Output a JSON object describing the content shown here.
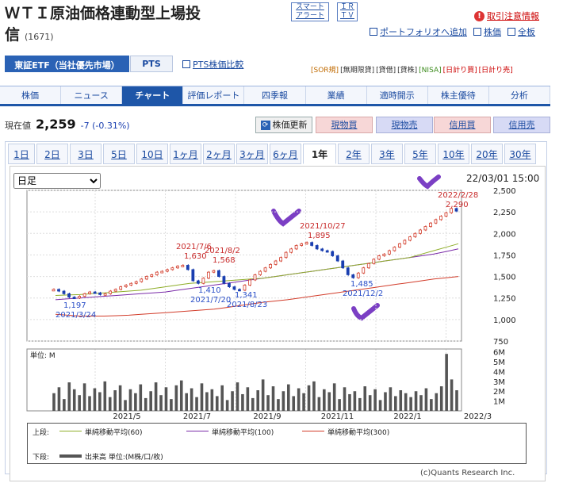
{
  "header": {
    "title_line1": "ＷＴＩ原油価格連動型上場投",
    "title_line2": "信",
    "code": "(1671)",
    "smart_alert_1": "スマート",
    "smart_alert_2": "アラート",
    "irtv_1": "ＩＲ",
    "irtv_2": "ＴＶ",
    "caution_link": "取引注意情報",
    "portfolio_link": "ポートフォリオへ追加",
    "stock_price_link": "株価",
    "full_board_link": "全板"
  },
  "market_tabs": {
    "etf": "東証ETF（当社優先市場）",
    "pts": "PTS",
    "pts_compare": "PTS株価比較"
  },
  "flags": [
    "[SOR規]",
    "[無期限貸]",
    "[貸借]",
    "[貸株]",
    "[NISA]",
    "[日計り買]",
    "[日計り売]"
  ],
  "nav": [
    "株価",
    "ニュース",
    "チャート",
    "評価レポート",
    "四季報",
    "業績",
    "適時開示",
    "株主優待",
    "分析"
  ],
  "price": {
    "label": "現在値",
    "value": "2,259",
    "change_prefix": "-7 (",
    "change_pct": "-0.31%",
    "change_suffix": ")"
  },
  "buttons": {
    "refresh": "株価更新",
    "buy_spot": "現物買",
    "sell_spot": "現物売",
    "buy_margin": "信用買",
    "sell_margin": "信用売"
  },
  "periods": [
    "1日",
    "2日",
    "3日",
    "5日",
    "10日",
    "1ヶ月",
    "2ヶ月",
    "3ヶ月",
    "6ヶ月",
    "1年",
    "2年",
    "3年",
    "5年",
    "10年",
    "20年",
    "30年"
  ],
  "chart": {
    "select_value": "日足",
    "timestamp": "22/03/01 15:00",
    "volume_unit_label": "単位: M",
    "legend_upper_label": "上段:",
    "legend_lower_label": "下段:",
    "ma60": "単純移動平均(60)",
    "ma100": "単純移動平均(100)",
    "ma300": "単純移動平均(300)",
    "volume_legend": "出来高 単位:(M株/口/枚)",
    "credit": "(c)Quants Research Inc.",
    "colors": {
      "ma60": "#8fae2a",
      "ma100": "#7a2ba8",
      "ma300": "#d23c2a",
      "candle": "#1a3fb0"
    }
  },
  "chart_data": {
    "type": "line",
    "price_ticks": [
      "2,500",
      "2,250",
      "2,000",
      "1,750",
      "1,500",
      "1,250",
      "1,000",
      "750"
    ],
    "volume_ticks": [
      "6M",
      "5M",
      "4M",
      "3M",
      "2M",
      "1M"
    ],
    "x_ticks": [
      "2021/5",
      "2021/7",
      "2021/9",
      "2021/11",
      "2022/1",
      "2022/3"
    ],
    "ylim": [
      750,
      2500
    ],
    "annotations": [
      {
        "date": "2021/3/24",
        "value": "1,197",
        "kind": "low"
      },
      {
        "date": "2021/7/6",
        "value": "1,630",
        "kind": "high"
      },
      {
        "date": "2021/7/20",
        "value": "1,410",
        "kind": "low"
      },
      {
        "date": "2021/8/2",
        "value": "1,568",
        "kind": "high"
      },
      {
        "date": "2021/8/23",
        "value": "1,341",
        "kind": "low"
      },
      {
        "date": "2021/10/27",
        "value": "1,895",
        "kind": "high"
      },
      {
        "date": "2021/12/2",
        "value": "1,485",
        "kind": "low"
      },
      {
        "date": "2022/2/28",
        "value": "2,290",
        "kind": "high"
      }
    ],
    "price_series": [
      1350,
      1330,
      1300,
      1260,
      1250,
      1270,
      1300,
      1320,
      1310,
      1290,
      1300,
      1330,
      1350,
      1380,
      1400,
      1420,
      1440,
      1470,
      1500,
      1520,
      1550,
      1560,
      1580,
      1600,
      1620,
      1630,
      1580,
      1450,
      1420,
      1480,
      1550,
      1568,
      1500,
      1420,
      1380,
      1350,
      1341,
      1400,
      1460,
      1520,
      1560,
      1600,
      1640,
      1680,
      1720,
      1780,
      1820,
      1860,
      1880,
      1895,
      1860,
      1820,
      1800,
      1790,
      1740,
      1680,
      1600,
      1520,
      1485,
      1540,
      1600,
      1650,
      1700,
      1740,
      1760,
      1800,
      1840,
      1880,
      1920,
      1960,
      2000,
      2040,
      2080,
      2120,
      2160,
      2200,
      2240,
      2290,
      2259
    ],
    "ma60_series": [
      1280,
      1285,
      1290,
      1300,
      1310,
      1320,
      1330,
      1340,
      1360,
      1380,
      1400,
      1420,
      1430,
      1440,
      1450,
      1460,
      1470,
      1480,
      1500,
      1520,
      1540,
      1560,
      1580,
      1600,
      1620,
      1640,
      1660,
      1680,
      1700,
      1720,
      1760,
      1800,
      1840,
      1880
    ],
    "ma100_series": [
      1230,
      1240,
      1250,
      1260,
      1270,
      1280,
      1290,
      1300,
      1310,
      1320,
      1340,
      1360,
      1380,
      1400,
      1420,
      1440,
      1460,
      1480,
      1500,
      1520,
      1540,
      1560,
      1580,
      1600,
      1620,
      1640,
      1660,
      1680,
      1700,
      1720,
      1740,
      1760,
      1790,
      1820
    ],
    "ma300_series": [
      1060,
      1050,
      1040,
      1040,
      1040,
      1045,
      1050,
      1060,
      1070,
      1080,
      1090,
      1100,
      1110,
      1120,
      1140,
      1160,
      1180,
      1200,
      1215,
      1230,
      1250,
      1270,
      1290,
      1310,
      1330,
      1350,
      1370,
      1390,
      1410,
      1430,
      1450,
      1470,
      1485,
      1500
    ],
    "volume_series": [
      1.8,
      2.4,
      1.2,
      2.9,
      2.2,
      1.6,
      2.8,
      1.5,
      2.3,
      1.9,
      3.0,
      1.4,
      2.1,
      2.6,
      1.1,
      2.2,
      1.8,
      2.7,
      1.3,
      2.0,
      2.9,
      1.6,
      2.4,
      1.2,
      2.6,
      3.1,
      1.8,
      2.3,
      1.4,
      2.8,
      1.9,
      2.2,
      1.5,
      2.6,
      1.1,
      2.0,
      2.9,
      1.7,
      2.4,
      1.3,
      2.1,
      3.2,
      1.6,
      2.5,
      1.2,
      2.0,
      2.7,
      1.5,
      2.3,
      1.8,
      2.6,
      3.0,
      1.4,
      2.2,
      1.9,
      2.8,
      1.2,
      2.4,
      1.7,
      2.0,
      1.3,
      2.5,
      1.6,
      2.2,
      1.1,
      1.9,
      2.4,
      1.5,
      2.1,
      1.8,
      1.4,
      2.0,
      1.6,
      2.3,
      1.2,
      1.8,
      2.5,
      5.8,
      3.2,
      2.1
    ]
  }
}
